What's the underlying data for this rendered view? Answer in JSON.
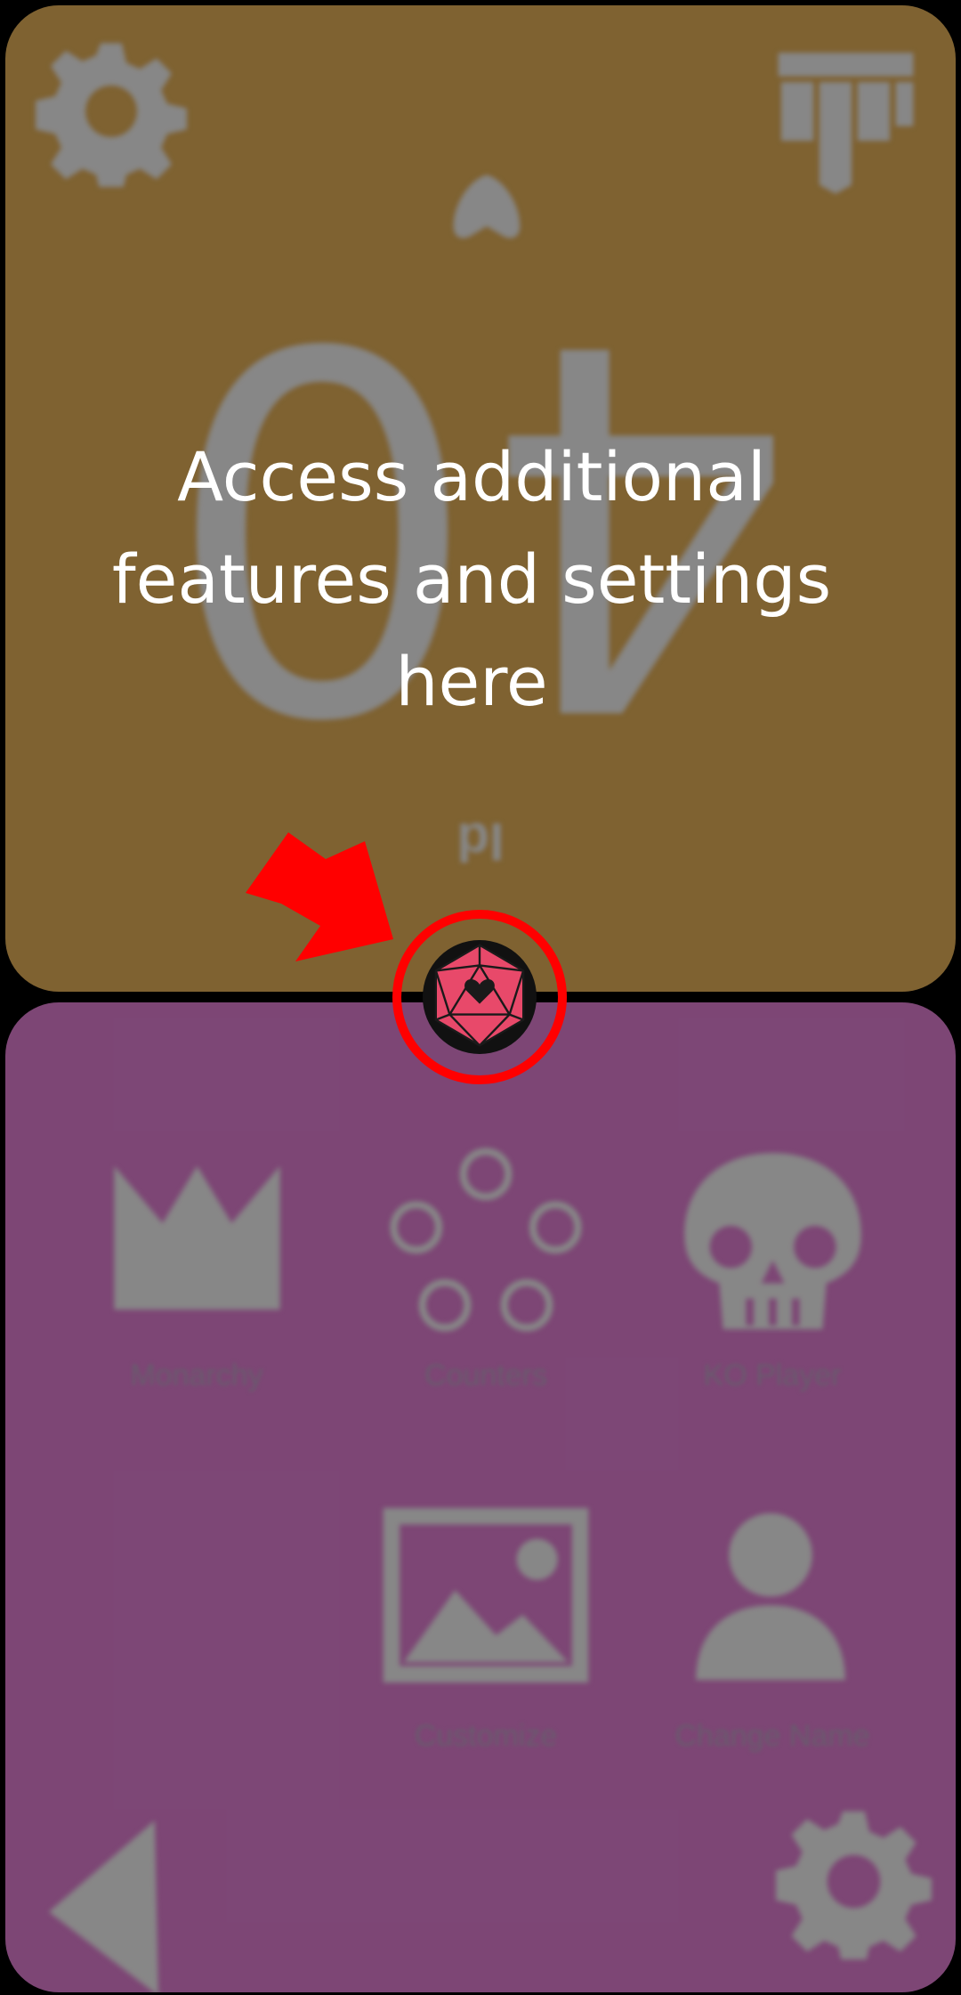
{
  "player_top": {
    "life_total": "40",
    "name": "Id",
    "color": "#826432",
    "icons": [
      "gear-icon",
      "commander-damage-icon",
      "chevron-up-icon"
    ]
  },
  "player_bottom": {
    "color": "#804878",
    "menu": [
      {
        "label": "Monarchy",
        "icon": "crown-icon"
      },
      {
        "label": "Counters",
        "icon": "counters-icon"
      },
      {
        "label": "KO Player",
        "icon": "skull-icon"
      },
      {
        "label": "Customize",
        "icon": "image-icon"
      },
      {
        "label": "Change Name",
        "icon": "person-icon"
      }
    ]
  },
  "tutorial": {
    "text": "Access additional features and settings here",
    "highlight_color": "#ff0000"
  },
  "center_button": {
    "icon": "d20-heart-icon"
  }
}
